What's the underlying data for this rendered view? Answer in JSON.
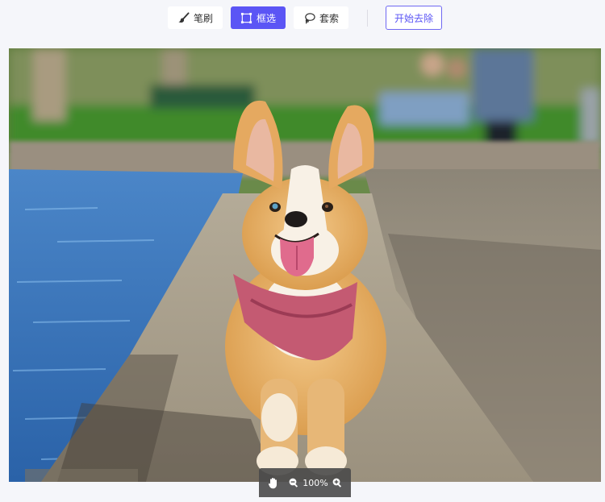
{
  "toolbar": {
    "brush_label": "笔刷",
    "box_select_label": "框选",
    "lasso_label": "套索",
    "action_label": "开始去除"
  },
  "zoom": {
    "level": "100%"
  },
  "icons": {
    "brush": "brush-icon",
    "box_select": "box-select-icon",
    "lasso": "lasso-icon",
    "hand": "hand-icon",
    "zoom_out": "zoom-out-icon",
    "zoom_in": "zoom-in-icon"
  },
  "colors": {
    "accent": "#5b55f5",
    "background": "#f5f6fa",
    "zoom_bar": "#4a4a4a"
  }
}
